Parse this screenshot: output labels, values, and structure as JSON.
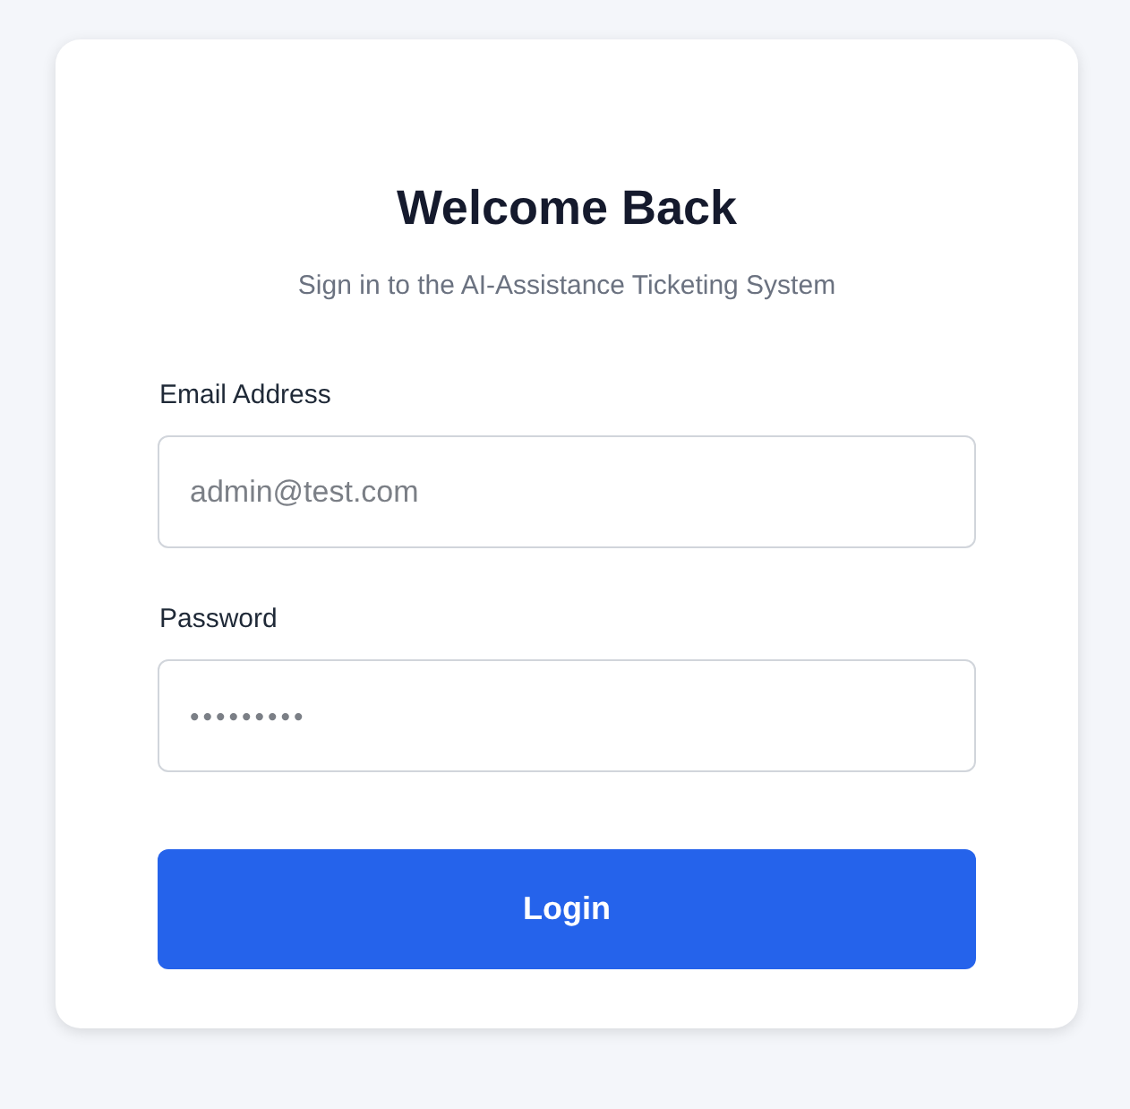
{
  "title": "Welcome Back",
  "subtitle": "Sign in to the AI-Assistance Ticketing System",
  "fields": [
    {
      "label": "Email Address",
      "kind": "text",
      "placeholder": "admin@test.com"
    },
    {
      "label": "Password",
      "kind": "secret",
      "placeholder": "•••••••••"
    }
  ],
  "button": "Login"
}
